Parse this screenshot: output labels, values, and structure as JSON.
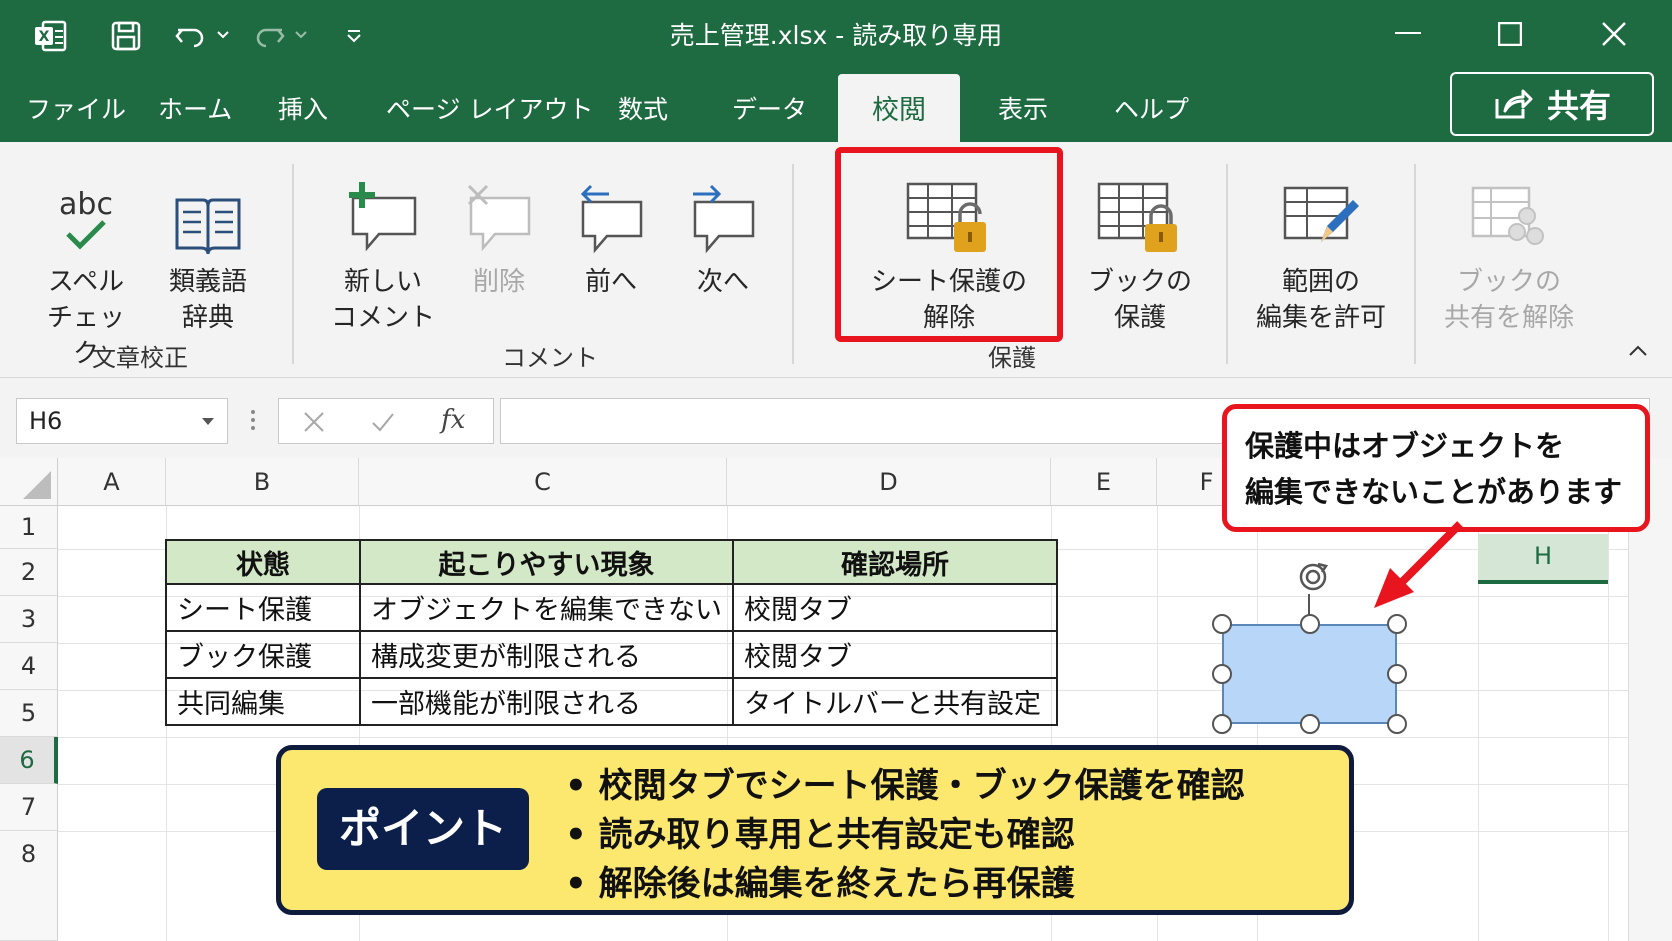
{
  "window": {
    "title": "売上管理.xlsx - 読み取り専用",
    "app_icon": "excel-icon",
    "qat": [
      "save-icon",
      "undo-icon",
      "redo-icon",
      "customize-icon"
    ],
    "controls": [
      "minimize-icon",
      "maximize-icon",
      "close-icon"
    ]
  },
  "tabs": [
    {
      "label": "ファイル"
    },
    {
      "label": "ホーム"
    },
    {
      "label": "挿入"
    },
    {
      "label": "ページ レイアウト"
    },
    {
      "label": "数式"
    },
    {
      "label": "データ"
    },
    {
      "label": "校閲",
      "active": true
    },
    {
      "label": "表示"
    },
    {
      "label": "ヘルプ"
    }
  ],
  "share": {
    "label": "共有"
  },
  "ribbon": {
    "spell": {
      "line1": "スペル",
      "line2": "チェック"
    },
    "thesaurus": {
      "line1": "類義語",
      "line2": "辞典"
    },
    "new_comment": {
      "line1": "新しい",
      "line2": "コメント"
    },
    "delete": {
      "line1": "削除"
    },
    "prev": {
      "line1": "前へ"
    },
    "next": {
      "line1": "次へ"
    },
    "unprotect_sheet": {
      "line1": "シート保護の",
      "line2": "解除"
    },
    "protect_book": {
      "line1": "ブックの",
      "line2": "保護"
    },
    "allow_edit_ranges": {
      "line1": "範囲の",
      "line2": "編集を許可"
    },
    "unshare_book": {
      "line1": "ブックの",
      "line2": "共有を解除"
    },
    "groups": {
      "proofing": "文章校正",
      "comments": "コメント",
      "protect": "保護"
    },
    "spell_icon_text": "abc"
  },
  "formula_bar": {
    "name_box": "H6",
    "fx": "fx",
    "value": ""
  },
  "grid": {
    "columns": [
      "A",
      "B",
      "C",
      "D",
      "E",
      "F"
    ],
    "rows": [
      "1",
      "2",
      "3",
      "4",
      "5",
      "6",
      "7",
      "8"
    ],
    "selected_row": "6",
    "selected_column_cell": "H"
  },
  "table": {
    "headers": [
      "状態",
      "起こりやすい現象",
      "確認場所"
    ],
    "rows": [
      [
        "シート保護",
        "オブジェクトを編集できない",
        "校閲タブ"
      ],
      [
        "ブック保護",
        "構成変更が制限される",
        "校閲タブ"
      ],
      [
        "共同編集",
        "一部機能が制限される",
        "タイトルバーと共有設定"
      ]
    ]
  },
  "callout": {
    "line1": "保護中はオブジェクトを",
    "line2": "編集できないことがあります"
  },
  "point": {
    "label": "ポイント",
    "items": [
      "校閲タブでシート保護・ブック保護を確認",
      "読み取り専用と共有設定も確認",
      "解除後は編集を終えたら再保護"
    ]
  },
  "colors": {
    "excel_green": "#1e6b41",
    "highlight_red": "#e8141e",
    "point_yellow": "#fde86f",
    "point_navy": "#0c1e4a",
    "table_header": "#d3e8c6",
    "shape_fill": "#b8d6f8"
  }
}
